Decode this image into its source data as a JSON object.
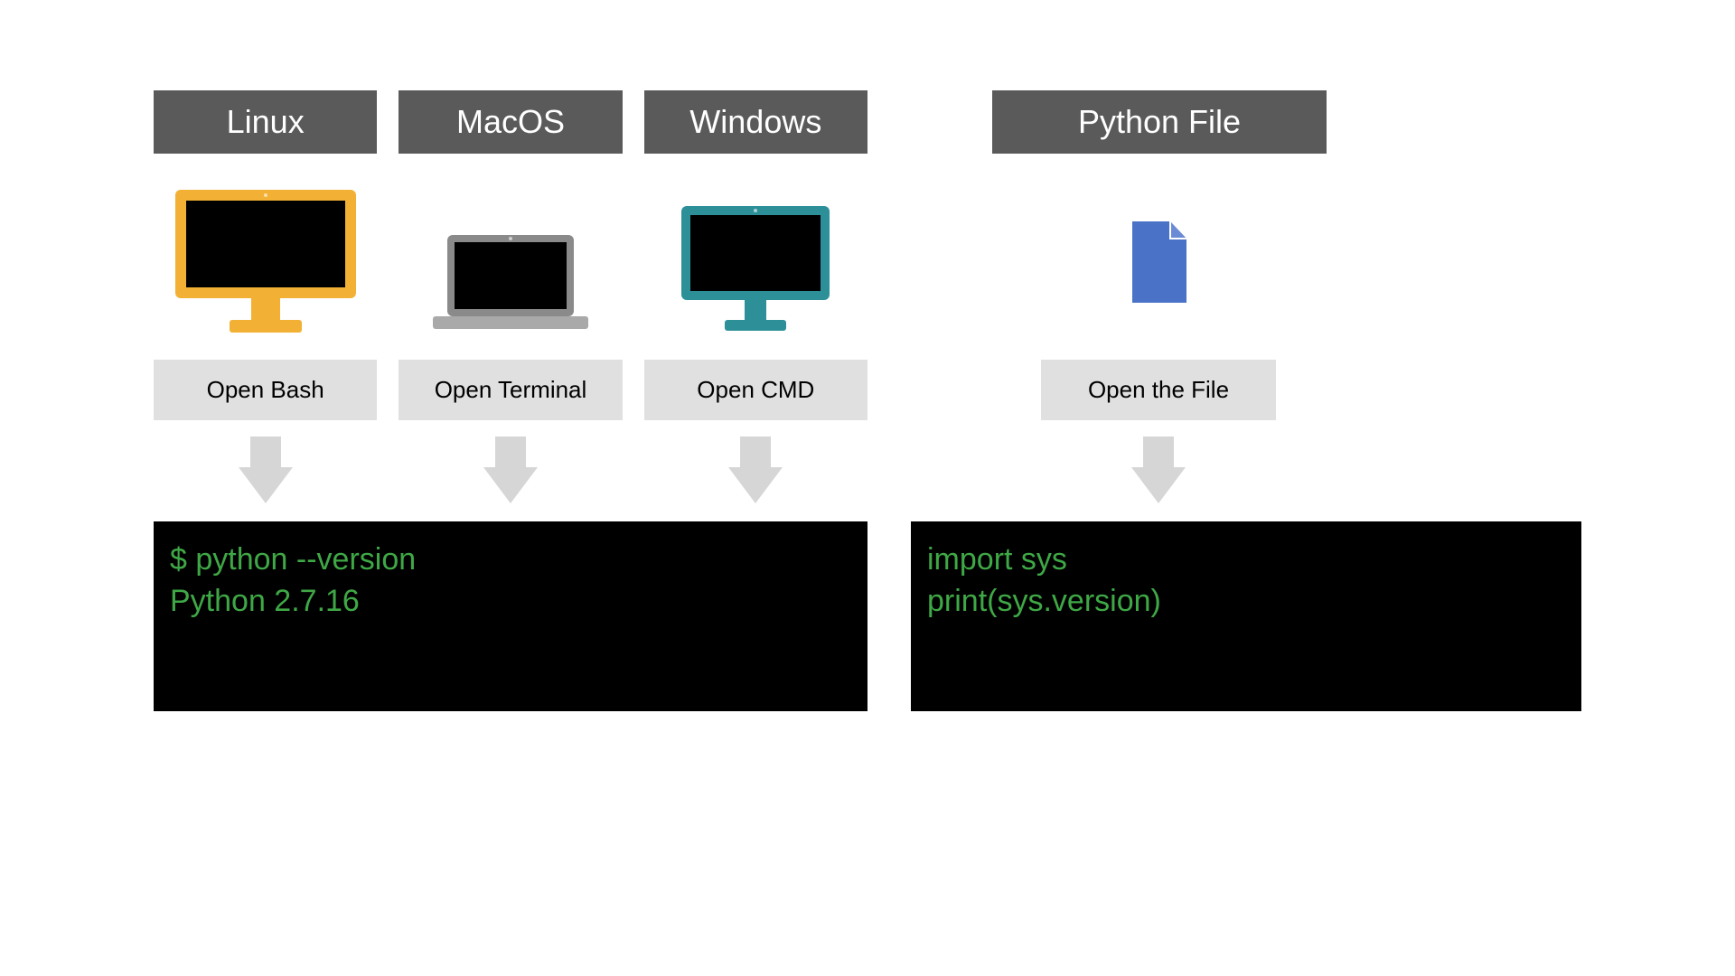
{
  "left": {
    "cols": [
      {
        "header": "Linux",
        "action": "Open Bash"
      },
      {
        "header": "MacOS",
        "action": "Open Terminal"
      },
      {
        "header": "Windows",
        "action": "Open CMD"
      }
    ],
    "terminal": "$ python --version\nPython 2.7.16"
  },
  "right": {
    "header": "Python File",
    "action": "Open the File",
    "terminal": "import sys\nprint(sys.version)"
  },
  "colors": {
    "header_bg": "#5a5a5a",
    "action_bg": "#e0e0e0",
    "terminal_bg": "#000000",
    "terminal_fg": "#3fa846",
    "arrow": "#d6d6d6"
  }
}
